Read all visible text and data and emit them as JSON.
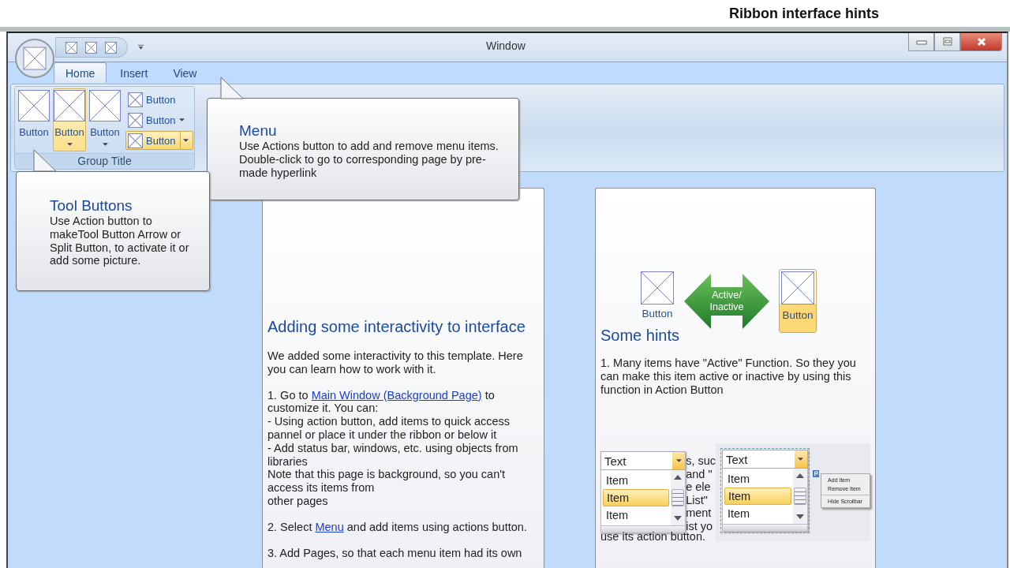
{
  "header": {
    "title": "Ribbon interface hints"
  },
  "window": {
    "title": "Window"
  },
  "tabs": [
    {
      "label": "Home",
      "selected": true
    },
    {
      "label": "Insert",
      "selected": false
    },
    {
      "label": "View",
      "selected": false
    }
  ],
  "ribbon_group": {
    "title": "Group Title",
    "large_buttons": [
      {
        "label": "Button",
        "kind": "plain",
        "active": false
      },
      {
        "label": "Button",
        "kind": "dropdown",
        "active": true
      },
      {
        "label": "Button",
        "kind": "dropdown",
        "active": false
      }
    ],
    "small_buttons": [
      {
        "label": "Button",
        "kind": "plain",
        "active": false
      },
      {
        "label": "Button",
        "kind": "dropdown",
        "active": false
      },
      {
        "label": "Button",
        "kind": "split",
        "active": true
      }
    ]
  },
  "callouts": [
    {
      "title": "Menu",
      "text": "Use Actions button to add and remove menu items.\nDouble-click to go to corresponding page by pre-\nmade hyperlink"
    },
    {
      "title": "Tool Buttons",
      "text": "Use Action button to\nmakeTool Button Arrow or\nSplit Button, to activate it or\nadd some picture."
    }
  ],
  "left_panel": {
    "heading": "Adding some interactivity to interface",
    "paragraphs": [
      [
        {
          "text": "We added some interactivity to this template. Here you can learn how to work with it."
        }
      ],
      [
        {
          "text": "1. Go to "
        },
        {
          "link": "Main Window (Background Page)"
        },
        {
          "text": "  to\ncustomize it. You can:\n- Using action button, add items to quick access pannel or place it under the ribbon or below it\n- Add  status bar, windows, etc. using objects from libraries\nNote that this page is background, so you can't\naccess its items from\nother pages"
        }
      ],
      [
        {
          "text": "2. Select "
        },
        {
          "link": "Menu"
        },
        {
          "text": " and add items using actions button."
        }
      ],
      [
        {
          "text": "3. Add Pages, so that each menu item had its own"
        }
      ]
    ]
  },
  "right_panel": {
    "demo": {
      "inactive_label": "Button",
      "arrow_label": "Active/\nInactive",
      "active_label": "Button"
    },
    "heading": "Some hints",
    "paragraph": "1. Many items have \"Active\" Function. So they you can make this item active or inactive by using this function in Action Button",
    "partial_lines": [
      "s, suc",
      "and \"",
      "e ele",
      "List\"",
      "ment",
      "ist yo"
    ],
    "last_line": "use its action button.",
    "list_demos": [
      {
        "text": "Text",
        "items": [
          {
            "label": "Item",
            "selected": false
          },
          {
            "label": "Item",
            "selected": true
          },
          {
            "label": "Item",
            "selected": false
          }
        ]
      },
      {
        "text": "Text",
        "items": [
          {
            "label": "Item",
            "selected": false
          },
          {
            "label": "Item",
            "selected": true
          },
          {
            "label": "Item",
            "selected": false
          }
        ]
      }
    ],
    "context_menu": [
      "Add Item",
      "Remove Item",
      "Hide Scrollbar"
    ]
  }
}
